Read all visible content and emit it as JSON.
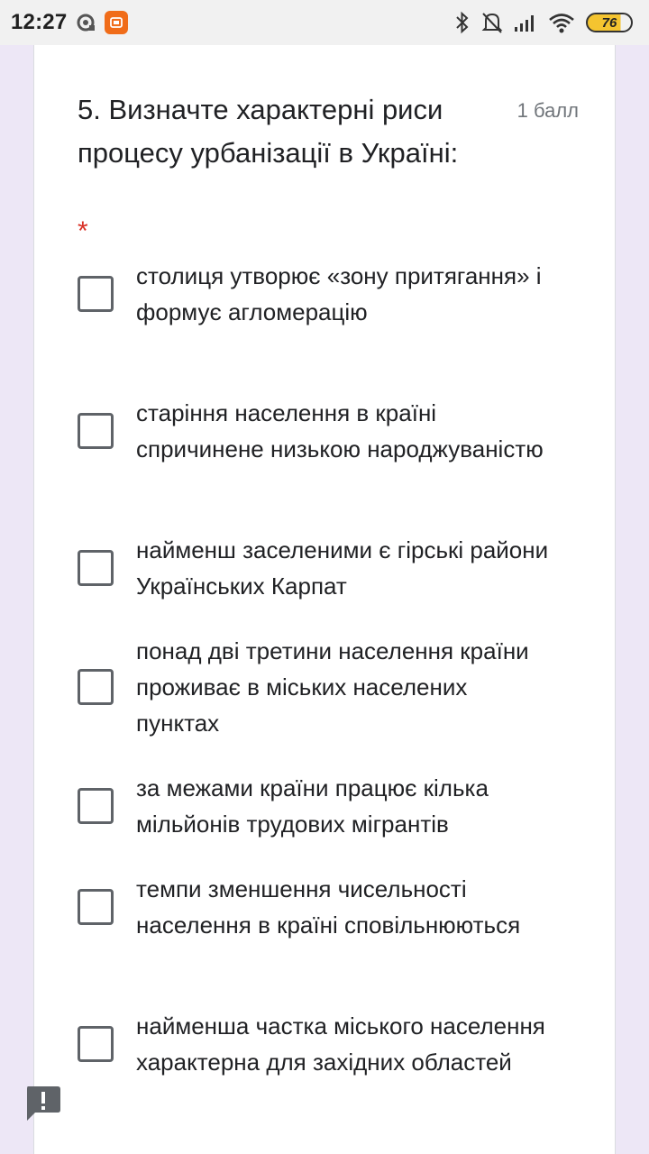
{
  "status_bar": {
    "time": "12:27",
    "battery_level": "76",
    "icons": [
      "record-icon",
      "app-notification-icon",
      "bluetooth-icon",
      "mute-bell-icon",
      "signal-icon",
      "wifi-icon",
      "battery-icon"
    ]
  },
  "question": {
    "title": "5. Визначте характерні риси процесу урбанізації в Україні:",
    "points": "1 балл",
    "required_mark": "*",
    "options": [
      {
        "label": "столиця утворює «зону притягання» і формує агломерацію",
        "checked": false
      },
      {
        "label": "старіння населення в країні спричинене низькою народжуваністю",
        "checked": false
      },
      {
        "label": "найменш заселеними є гірські райони Українських Карпат",
        "checked": false
      },
      {
        "label": "понад дві третини населення країни проживає в міських населених пунктах",
        "checked": false
      },
      {
        "label": "за межами країни працює кілька мільйонів трудових мігрантів",
        "checked": false
      },
      {
        "label": "темпи зменшення чисельності населення в країні сповільнюються",
        "checked": false
      },
      {
        "label": "найменша частка міського населення характерна для західних областей",
        "checked": false
      }
    ]
  },
  "colors": {
    "page_background": "#ede7f6",
    "required": "#d93025",
    "text": "#202124",
    "muted": "#70757a"
  }
}
